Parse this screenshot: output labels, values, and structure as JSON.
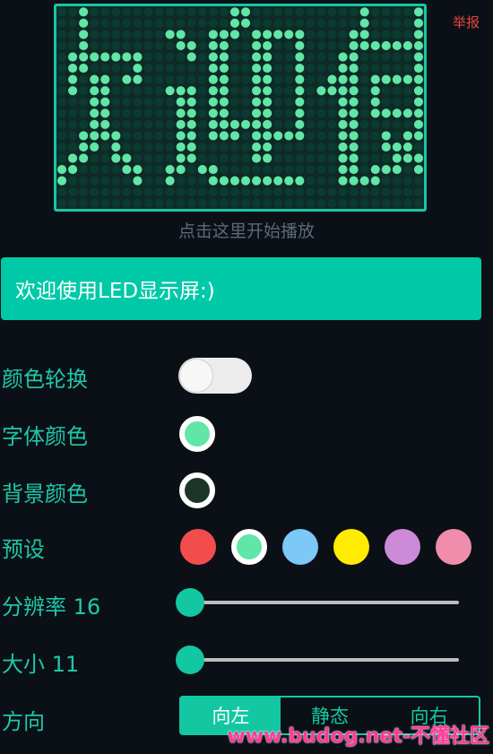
{
  "report": "举报",
  "led": {
    "text": "欢迎使用LED显示屏:)",
    "on_color": "#60e6a6",
    "off_color": "#0a3a30",
    "bg_color": "#0f2a26",
    "border_color": "#17c7a4"
  },
  "hint": "点击这里开始播放",
  "input": {
    "value": "欢迎使用LED显示屏:)",
    "bg": "#00c9a7"
  },
  "settings": {
    "color_cycle": {
      "label": "颜色轮换",
      "on": false
    },
    "font_color": {
      "label": "字体颜色",
      "value": "#60e6a6"
    },
    "bg_color": {
      "label": "背景颜色",
      "value": "#1d3529"
    },
    "presets": {
      "label": "预设",
      "colors": [
        "#f24d4d",
        "#60e6a6",
        "#7cc8f7",
        "#ffec00",
        "#cc8ad8",
        "#f08cac"
      ],
      "selected_index": 1
    },
    "resolution": {
      "label": "分辨率 16",
      "value": 16
    },
    "size": {
      "label": "大小 11",
      "value": 11
    },
    "direction": {
      "label": "方向",
      "options": [
        "向左",
        "静态",
        "向右"
      ],
      "selected_index": 0
    }
  },
  "accent": "#13c7a3",
  "watermark": "www.budog.net-不懂社区"
}
